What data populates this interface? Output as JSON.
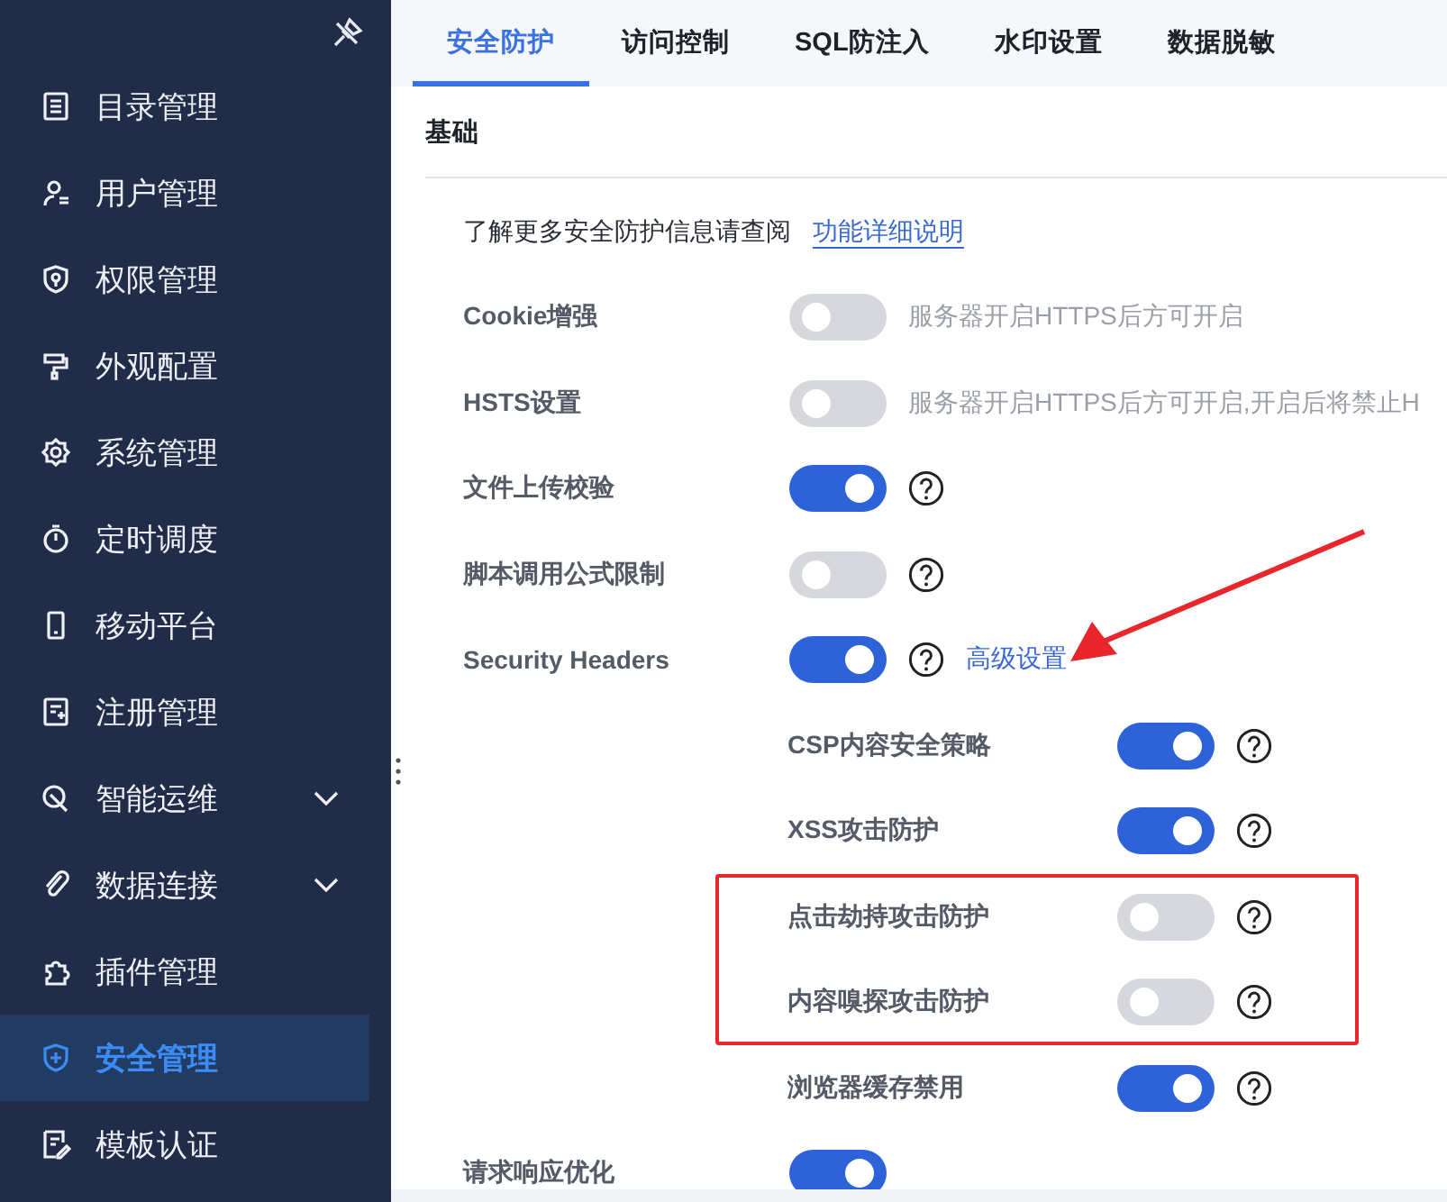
{
  "sidebar": {
    "items": [
      {
        "label": "目录管理",
        "expandable": false,
        "selected": false
      },
      {
        "label": "用户管理",
        "expandable": false,
        "selected": false
      },
      {
        "label": "权限管理",
        "expandable": false,
        "selected": false
      },
      {
        "label": "外观配置",
        "expandable": false,
        "selected": false
      },
      {
        "label": "系统管理",
        "expandable": false,
        "selected": false
      },
      {
        "label": "定时调度",
        "expandable": false,
        "selected": false
      },
      {
        "label": "移动平台",
        "expandable": false,
        "selected": false
      },
      {
        "label": "注册管理",
        "expandable": false,
        "selected": false
      },
      {
        "label": "智能运维",
        "expandable": true,
        "selected": false
      },
      {
        "label": "数据连接",
        "expandable": true,
        "selected": false
      },
      {
        "label": "插件管理",
        "expandable": false,
        "selected": false
      },
      {
        "label": "安全管理",
        "expandable": false,
        "selected": true
      },
      {
        "label": "模板认证",
        "expandable": false,
        "selected": false
      }
    ]
  },
  "tabs": [
    {
      "label": "安全防护",
      "selected": true
    },
    {
      "label": "访问控制",
      "selected": false
    },
    {
      "label": "SQL防注入",
      "selected": false
    },
    {
      "label": "水印设置",
      "selected": false
    },
    {
      "label": "数据脱敏",
      "selected": false
    }
  ],
  "section": {
    "title": "基础"
  },
  "rows": [
    {
      "kind": "info",
      "text": "了解更多安全防护信息请查阅",
      "link": "功能详细说明"
    },
    {
      "kind": "toggle",
      "label": "Cookie增强",
      "on": false,
      "note": "服务器开启HTTPS后方可开启"
    },
    {
      "kind": "toggle",
      "label": "HSTS设置",
      "on": false,
      "note": "服务器开启HTTPS后方可开启,开启后将禁止H"
    },
    {
      "kind": "toggle",
      "label": "文件上传校验",
      "on": true,
      "help": true
    },
    {
      "kind": "toggle",
      "label": "脚本调用公式限制",
      "on": false,
      "help": true
    },
    {
      "kind": "toggle",
      "label": "Security Headers",
      "on": true,
      "help": true,
      "link": "高级设置",
      "arrow": true,
      "children": [
        {
          "label": "CSP内容安全策略",
          "on": true,
          "highlighted": false
        },
        {
          "label": "XSS攻击防护",
          "on": true,
          "highlighted": false
        },
        {
          "label": "点击劫持攻击防护",
          "on": false,
          "highlighted": true
        },
        {
          "label": "内容嗅探攻击防护",
          "on": false,
          "highlighted": true
        },
        {
          "label": "浏览器缓存禁用",
          "on": true,
          "highlighted": false
        }
      ]
    },
    {
      "kind": "toggle",
      "label": "请求响应优化",
      "on": true
    }
  ]
}
